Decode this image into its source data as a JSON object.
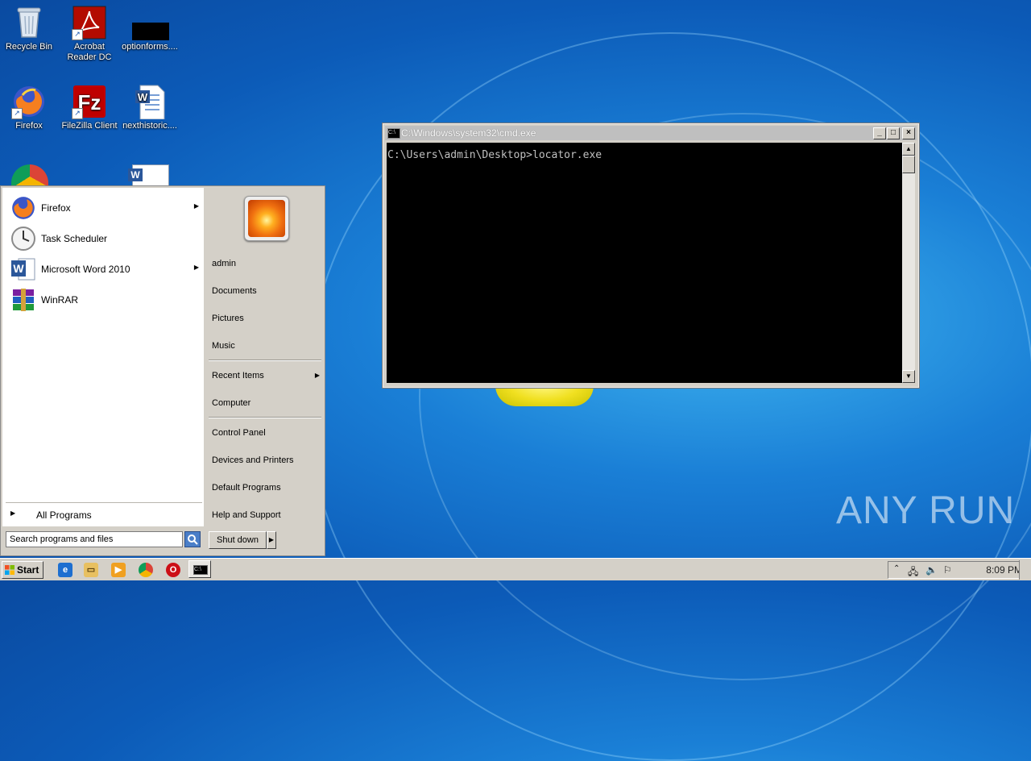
{
  "desktop": {
    "icons": [
      {
        "label": "Recycle Bin",
        "icon": "recycle-bin-icon"
      },
      {
        "label": "Acrobat\nReader DC",
        "icon": "acrobat-icon"
      },
      {
        "label": "optionforms....",
        "icon": "file-icon"
      },
      {
        "label": "Firefox",
        "icon": "firefox-icon"
      },
      {
        "label": "FileZilla Client",
        "icon": "filezilla-icon"
      },
      {
        "label": "nexthistoric....",
        "icon": "word-doc-icon"
      }
    ],
    "watermark": "ANY RUN"
  },
  "cmd_window": {
    "title": "C:\\Windows\\system32\\cmd.exe",
    "prompt_line": "C:\\Users\\admin\\Desktop>locator.exe"
  },
  "start_menu": {
    "programs": [
      {
        "label": "Firefox",
        "has_submenu": true
      },
      {
        "label": "Task Scheduler",
        "has_submenu": false
      },
      {
        "label": "Microsoft Word 2010",
        "has_submenu": true
      },
      {
        "label": "WinRAR",
        "has_submenu": false
      }
    ],
    "all_programs": "All Programs",
    "search_placeholder": "Search programs and files",
    "right_items": {
      "admin": "admin",
      "documents": "Documents",
      "pictures": "Pictures",
      "music": "Music",
      "recent_items": "Recent Items",
      "computer": "Computer",
      "control_panel": "Control Panel",
      "devices_printers": "Devices and Printers",
      "default_programs": "Default Programs",
      "help_support": "Help and Support"
    },
    "shutdown": "Shut down"
  },
  "taskbar": {
    "start_label": "Start",
    "clock": "8:09 PM"
  }
}
